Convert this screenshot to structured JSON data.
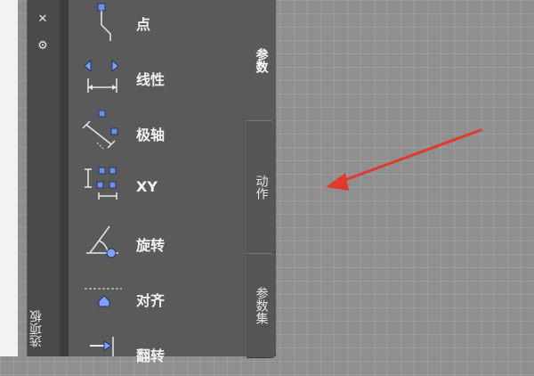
{
  "panel": {
    "side_label": "选项板",
    "controls": [
      {
        "icon": "close-icon",
        "glyph": "✕"
      },
      {
        "icon": "settings-icon",
        "glyph": "⚙"
      }
    ]
  },
  "parameters": [
    {
      "label": "点",
      "icon": "point-parameter-icon"
    },
    {
      "label": "线性",
      "icon": "linear-parameter-icon"
    },
    {
      "label": "极轴",
      "icon": "polar-parameter-icon"
    },
    {
      "label": "XY",
      "icon": "xy-parameter-icon"
    },
    {
      "label": "旋转",
      "icon": "rotation-parameter-icon"
    },
    {
      "label": "对齐",
      "icon": "alignment-parameter-icon"
    },
    {
      "label": "翻转",
      "icon": "flip-parameter-icon"
    }
  ],
  "tabs": [
    {
      "label": "参数",
      "active": true
    },
    {
      "label": "动作",
      "active": false
    },
    {
      "label": "参数集",
      "active": false
    }
  ],
  "annotation": {
    "color": "#e03a2e",
    "type": "red-arrow"
  }
}
